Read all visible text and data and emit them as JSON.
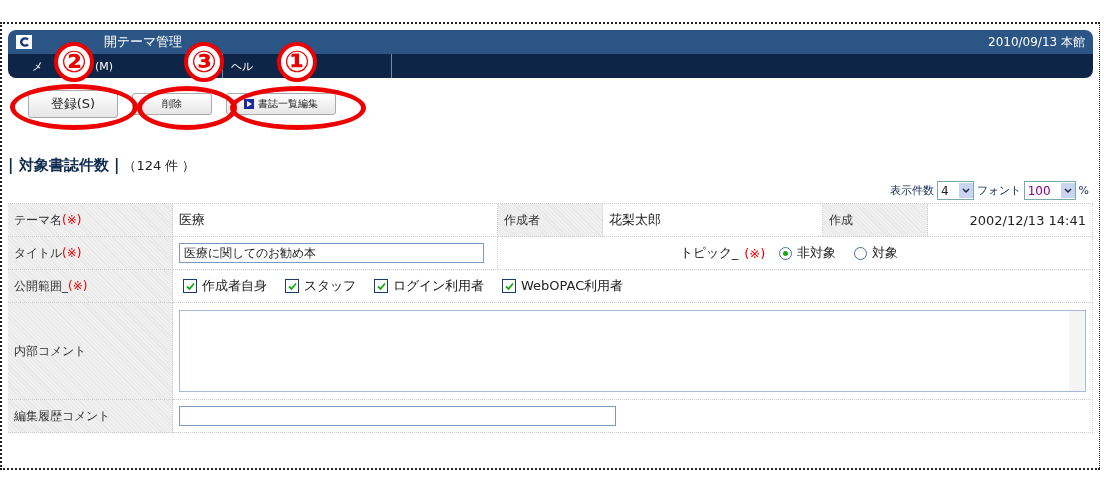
{
  "header": {
    "title": "開テーマ管理",
    "date": "2010/09/13 本館"
  },
  "menu": [
    {
      "parts": [
        "メ",
        "(M)"
      ]
    },
    {
      "parts": [
        "ヘル"
      ]
    }
  ],
  "toolbar": [
    {
      "label": "登録(S)",
      "kind": "large",
      "badge": "②"
    },
    {
      "label": "削除",
      "kind": "small",
      "badge": "③"
    },
    {
      "label": "書誌一覧編集",
      "kind": "icon",
      "badge": "①"
    }
  ],
  "count": {
    "label": "| 対象書誌件数 |",
    "value": "（124 件 ）"
  },
  "display": {
    "count_label": "表示件数",
    "count_value": "4",
    "font_label": "フォント",
    "font_value": "100",
    "unit": "%"
  },
  "form": {
    "theme": {
      "label": "テーマ名",
      "required": "(※)",
      "value": "医療",
      "author_label": "作成者",
      "author": "花梨太郎",
      "created_label": "作成",
      "created": "2002/12/13 14:41"
    },
    "title": {
      "label": "タイトル",
      "required": "(※)",
      "value": "医療に関してのお勧め本",
      "topic_label": "トピック_",
      "topic_required": "(※)",
      "options": [
        {
          "label": "非対象",
          "selected": true
        },
        {
          "label": "対象",
          "selected": false
        }
      ]
    },
    "scope": {
      "label": "公開範囲_",
      "required": "(※)",
      "options": [
        {
          "label": "作成者自身",
          "checked": true
        },
        {
          "label": "スタッフ",
          "checked": true
        },
        {
          "label": "ログイン利用者",
          "checked": true
        },
        {
          "label": "WebOPAC利用者",
          "checked": true
        }
      ]
    },
    "internal_comment": {
      "label": "内部コメント"
    },
    "history_comment": {
      "label": "編集履歴コメント"
    }
  }
}
